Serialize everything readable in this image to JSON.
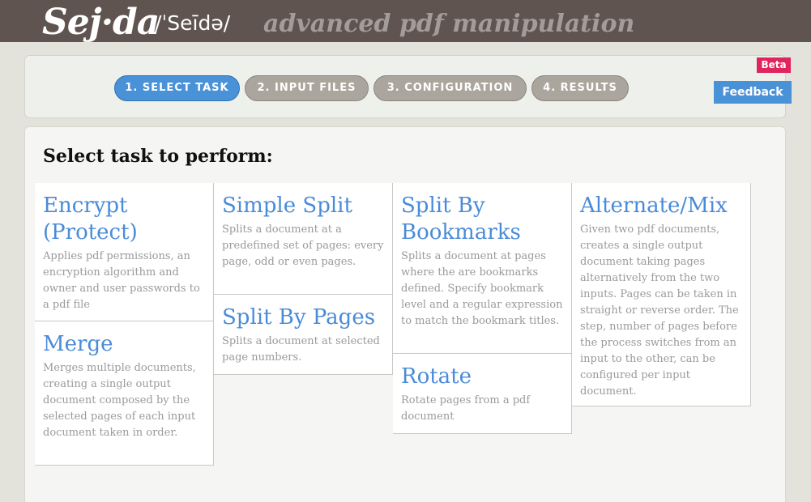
{
  "header": {
    "logo": "Sej·da",
    "pronunciation": "/ˈSeīdə/",
    "tagline": "advanced pdf manipulation"
  },
  "steps": [
    {
      "label": "1. SELECT TASK",
      "active": true
    },
    {
      "label": "2. INPUT FILES",
      "active": false
    },
    {
      "label": "3. CONFIGURATION",
      "active": false
    },
    {
      "label": "4. RESULTS",
      "active": false
    }
  ],
  "beta_label": "Beta",
  "feedback_label": "Feedback",
  "page_title": "Select task to perform:",
  "tasks": {
    "encrypt": {
      "title": "Encrypt (Protect)",
      "desc": "Applies pdf permissions, an encryption algorithm and owner and user passwords to a pdf file"
    },
    "merge": {
      "title": "Merge",
      "desc": "Merges multiple documents, creating a single output document composed by the selected pages of each input document taken in order."
    },
    "simple_split": {
      "title": "Simple Split",
      "desc": "Splits a document at a predefined set of pages: every page, odd or even pages."
    },
    "split_by_pages": {
      "title": "Split By Pages",
      "desc": "Splits a document at selected page numbers."
    },
    "split_by_bookmarks": {
      "title": "Split By Bookmarks",
      "desc": "Splits a document at pages where the are bookmarks defined. Specify bookmark level and a regular expression to match the bookmark titles."
    },
    "rotate": {
      "title": "Rotate",
      "desc": "Rotate pages from a pdf document"
    },
    "alternate_mix": {
      "title": "Alternate/Mix",
      "desc": "Given two pdf documents, creates a single output document taking pages alternatively from the two inputs. Pages can be taken in straight or reverse order. The step, number of pages before the process switches from an input to the other, can be configured per input document."
    }
  },
  "colors": {
    "header_bg": "#5f5450",
    "accent_blue": "#4a92d8",
    "step_inactive": "#aba69d",
    "beta_pink": "#e0245e",
    "title_blue": "#4a8bd8"
  }
}
